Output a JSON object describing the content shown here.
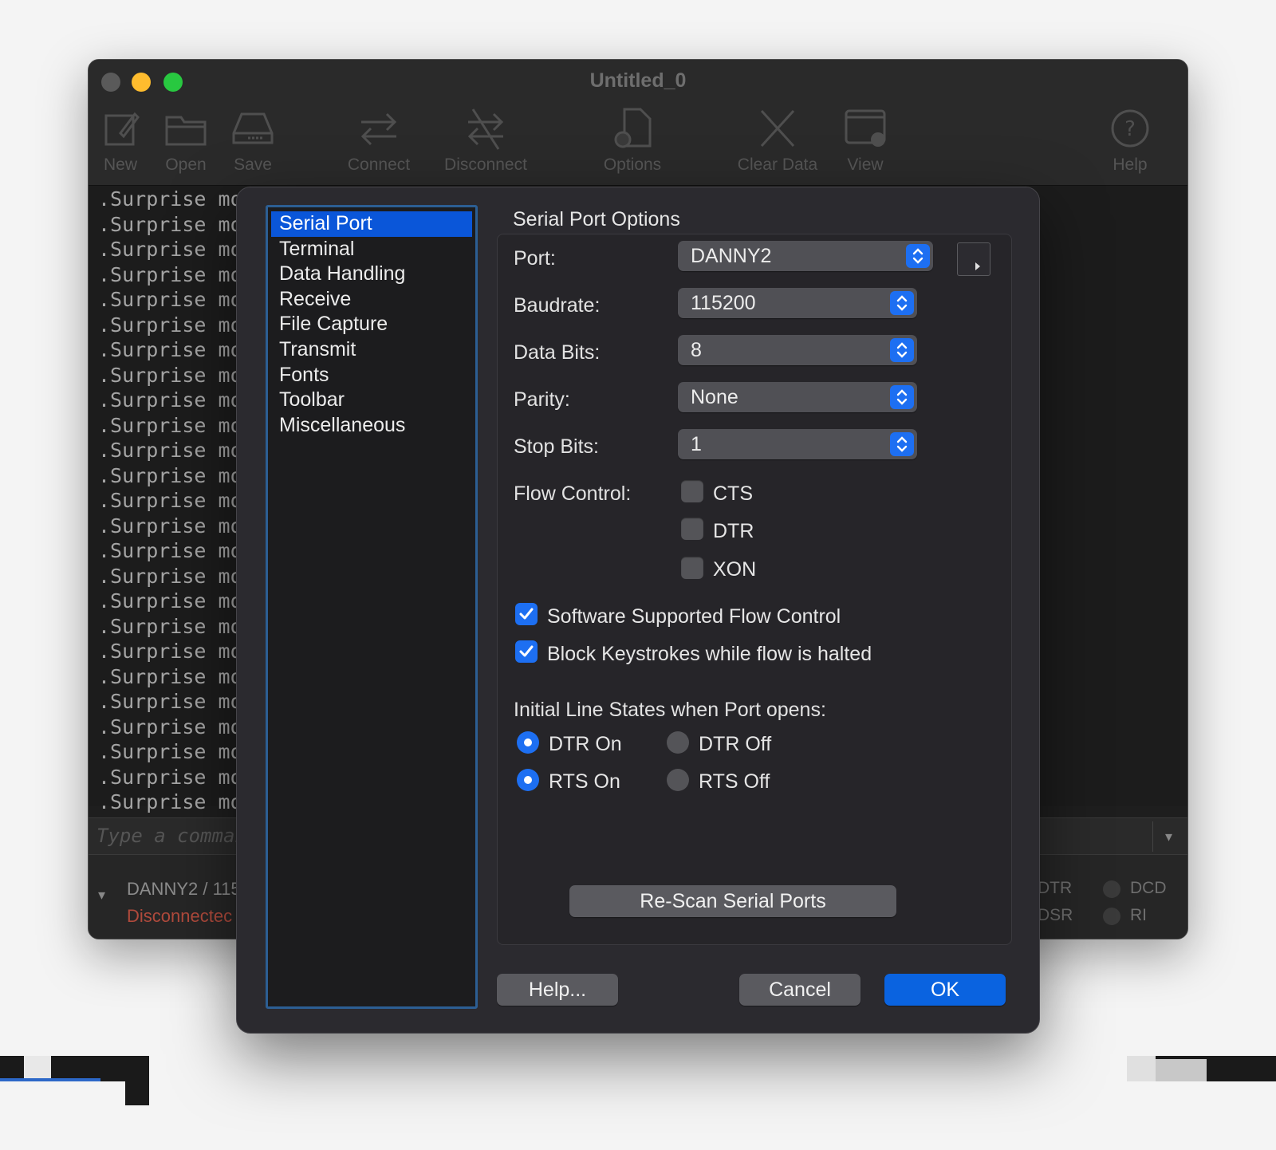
{
  "window": {
    "title": "Untitled_0",
    "toolbar": {
      "new": "New",
      "open": "Open",
      "save": "Save",
      "connect": "Connect",
      "disconnect": "Disconnect",
      "options": "Options",
      "clear_data": "Clear Data",
      "view": "View",
      "help": "Help"
    },
    "terminal_line": ".Surprise mot",
    "command_placeholder": "Type a comman",
    "status": {
      "port": "DANNY2 / 115",
      "connection": "Disconnectec",
      "dtr": "DTR",
      "dsr": "DSR",
      "dcd": "DCD",
      "ri": "RI"
    }
  },
  "dialog": {
    "categories": [
      "Serial Port",
      "Terminal",
      "Data Handling",
      "Receive",
      "File Capture",
      "Transmit",
      "Fonts",
      "Toolbar",
      "Miscellaneous"
    ],
    "selected_category": "Serial Port",
    "section_title": "Serial Port Options",
    "port": {
      "label": "Port:",
      "value": "DANNY2"
    },
    "baudrate": {
      "label": "Baudrate:",
      "value": "115200"
    },
    "data_bits": {
      "label": "Data Bits:",
      "value": "8"
    },
    "parity": {
      "label": "Parity:",
      "value": "None"
    },
    "stop_bits": {
      "label": "Stop Bits:",
      "value": "1"
    },
    "flow_control": {
      "label": "Flow Control:",
      "cts": "CTS",
      "dtr": "DTR",
      "xon": "XON"
    },
    "software_flow_control": "Software Supported Flow Control",
    "block_keystrokes": "Block Keystrokes while flow is halted",
    "line_states": {
      "label": "Initial Line States when Port opens:",
      "dtr_on": "DTR On",
      "dtr_off": "DTR Off",
      "rts_on": "RTS On",
      "rts_off": "RTS Off"
    },
    "rescan_button": "Re-Scan Serial Ports",
    "help_button": "Help...",
    "cancel_button": "Cancel",
    "ok_button": "OK"
  },
  "colors": {
    "accent": "#1d6ff2",
    "selection": "#0a56d9",
    "ok_button": "#0a63e0",
    "disconnected": "#b04a3c"
  }
}
